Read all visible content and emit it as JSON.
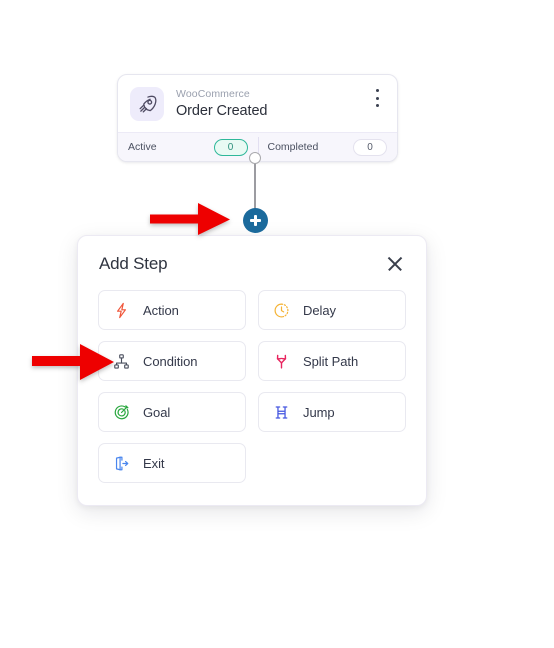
{
  "canvas": {
    "background": "#ffffff"
  },
  "trigger_node": {
    "app_name": "WooCommerce",
    "title": "Order Created",
    "icon": "rocket-icon",
    "icon_background": "#eeecfb",
    "menu_icon": "more-vertical-icon",
    "stats": [
      {
        "label": "Active",
        "value": "0",
        "accent": "#2fb89a"
      },
      {
        "label": "Completed",
        "value": "0",
        "accent": "#e4e2ee"
      }
    ]
  },
  "connector": {
    "add_button_label": "+",
    "add_button_color": "#1b6a9c",
    "line_color": "#9c9ca1"
  },
  "panel": {
    "title": "Add Step",
    "close_label": "×",
    "steps": [
      {
        "label": "Action",
        "icon": "lightning-bolt-icon",
        "color": "#f0563a"
      },
      {
        "label": "Delay",
        "icon": "clock-icon",
        "color": "#f5b335"
      },
      {
        "label": "Condition",
        "icon": "hierarchy-icon",
        "color": "#4a4f5e"
      },
      {
        "label": "Split Path",
        "icon": "split-path-icon",
        "color": "#e8255f"
      },
      {
        "label": "Goal",
        "icon": "target-goal-icon",
        "color": "#2aa83f"
      },
      {
        "label": "Jump",
        "icon": "jump-icon",
        "color": "#4456e0"
      },
      {
        "label": "Exit",
        "icon": "exit-door-icon",
        "color": "#4a86ee"
      }
    ]
  },
  "annotations": [
    {
      "name": "arrow-pointing-to-add-button",
      "color": "#ee0000",
      "direction": "right"
    },
    {
      "name": "arrow-pointing-to-condition",
      "color": "#ee0000",
      "direction": "right"
    }
  ]
}
